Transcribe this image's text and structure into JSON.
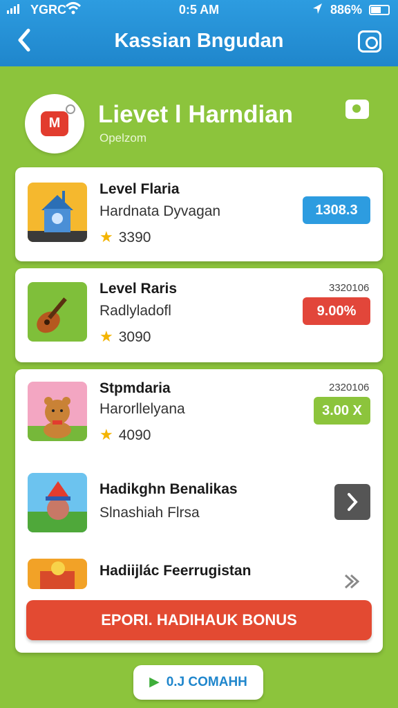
{
  "status_bar": {
    "carrier": "YGRC",
    "time": "0:5 AM",
    "battery": "886%",
    "wifi_icon": "wifi-icon",
    "location_icon": "location-arrow-icon"
  },
  "header": {
    "title": "Kassian Bngudan",
    "back_icon": "chevron-left-icon",
    "action_icon": "share-icon"
  },
  "profile": {
    "logo_text": "M",
    "title": "Lievet l Harndian",
    "subtitle": "Opelzom",
    "camera_icon": "camera-icon"
  },
  "items": [
    {
      "title": "Level Flaria",
      "subtitle": "Hardnata Dyvagan",
      "rating": "3390",
      "badge": "1308.3",
      "badge_color": "#2d9ce0",
      "meta": ""
    },
    {
      "title": "Level Raris",
      "subtitle": "Radlyladofl",
      "rating": "3090",
      "badge": "9.00%",
      "badge_color": "#e2463a",
      "meta": "3320106"
    },
    {
      "title": "Stpmdaria",
      "subtitle": "Harorllelyana",
      "rating": "4090",
      "badge": "3.00 X",
      "badge_color": "#8cc43c",
      "meta": "2320106"
    },
    {
      "title": "Hadikghn Benalikas",
      "subtitle": "Slnashiah Flrsa",
      "action_icon": "chevron-right-icon"
    },
    {
      "title": "Hadiijlác Feerrugistan",
      "subtitle": "",
      "action_icon": "double-chevron-icon"
    }
  ],
  "buttons": {
    "bonus": "EPORI. HADIHAUK BONUS",
    "command": "0.J COMAHH",
    "command_icon": "play-icon"
  },
  "colors": {
    "header_blue": "#1f86cc",
    "background_green": "#8cc43c",
    "bonus_red": "#e34a32"
  }
}
